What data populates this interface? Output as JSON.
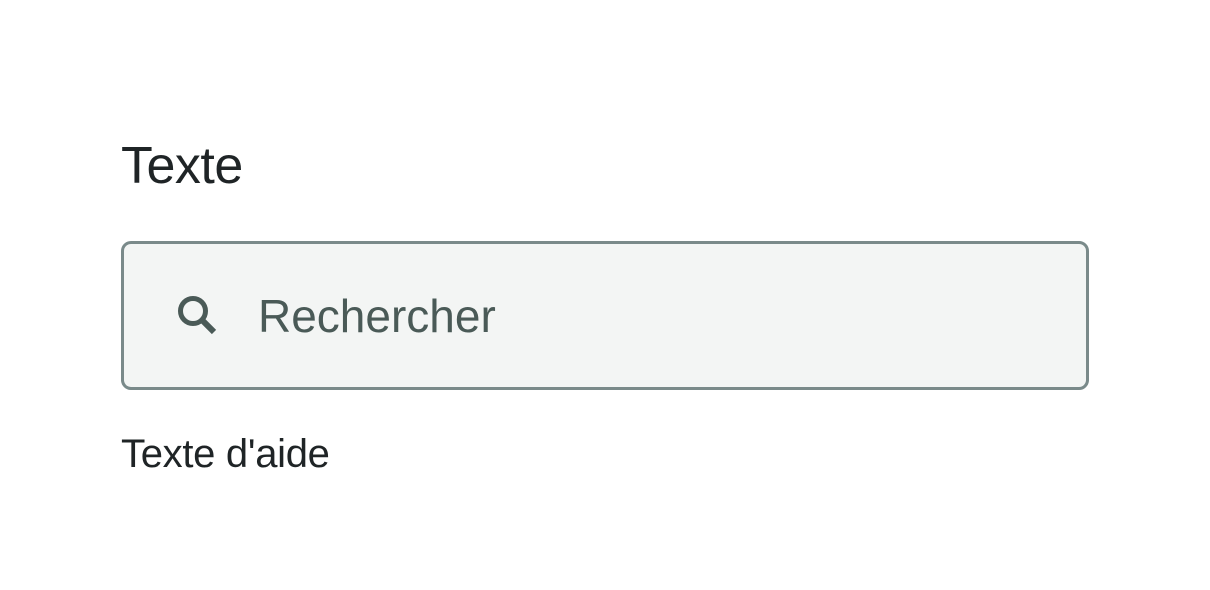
{
  "field": {
    "label": "Texte",
    "search": {
      "placeholder": "Rechercher",
      "value": "",
      "icon": "search-icon"
    },
    "help_text": "Texte d'aide"
  },
  "colors": {
    "label_text": "#1f2426",
    "input_background": "#f3f5f4",
    "input_border": "#7a8a8a",
    "placeholder_text": "#4a5a57",
    "icon": "#4a5a57"
  }
}
